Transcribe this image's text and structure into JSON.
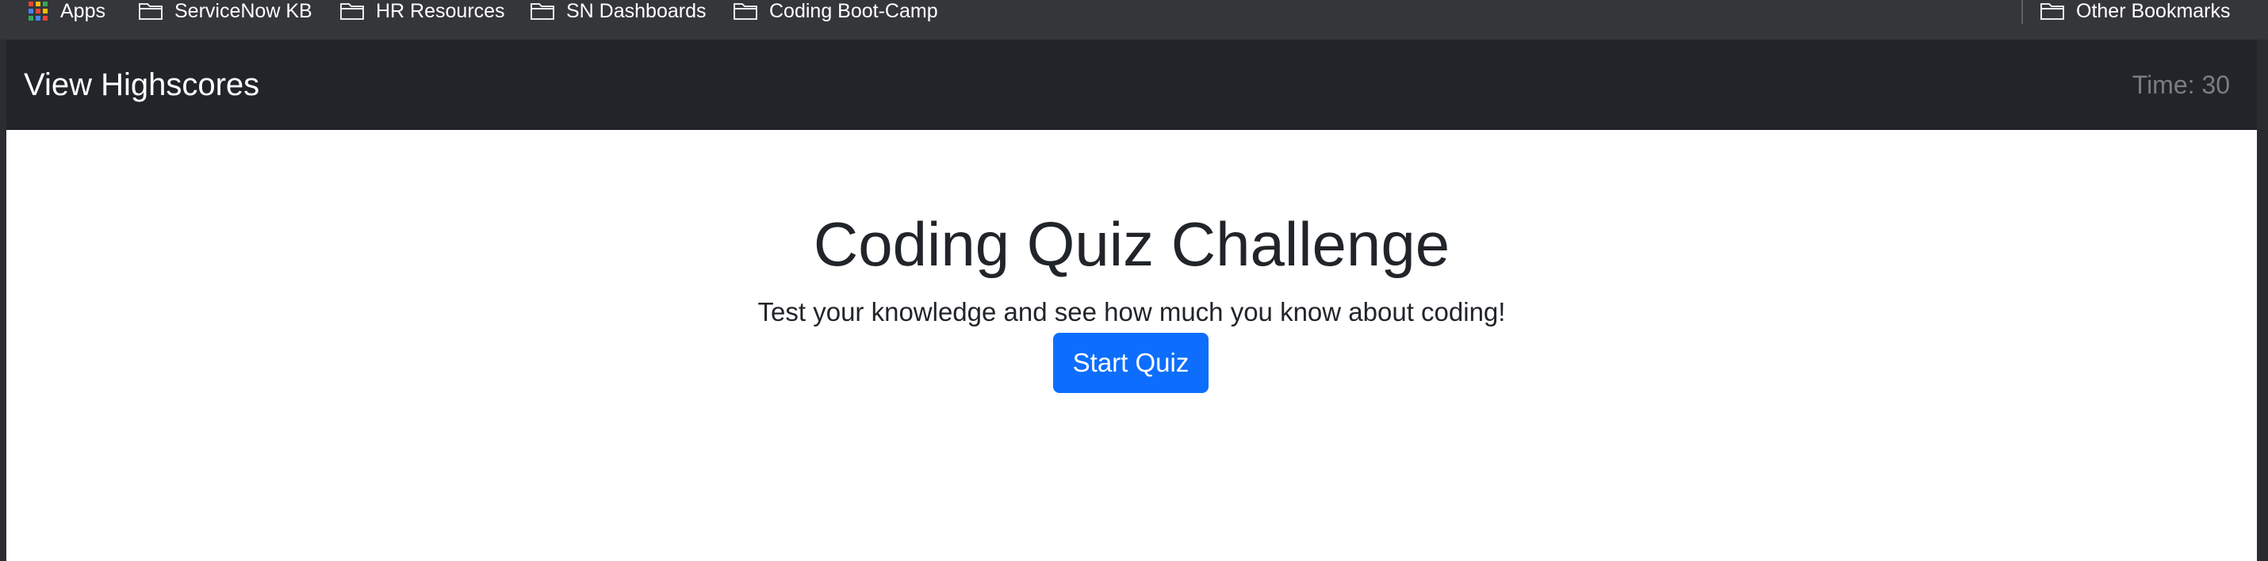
{
  "bookmarks": {
    "items": [
      {
        "label": "Apps",
        "icon": "apps-grid-icon"
      },
      {
        "label": "ServiceNow KB",
        "icon": "folder-icon"
      },
      {
        "label": "HR Resources",
        "icon": "folder-icon"
      },
      {
        "label": "SN Dashboards",
        "icon": "folder-icon"
      },
      {
        "label": "Coding Boot-Camp",
        "icon": "folder-icon"
      }
    ],
    "other": {
      "label": "Other Bookmarks",
      "icon": "folder-icon"
    }
  },
  "navbar": {
    "highscores_link": "View Highscores",
    "timer": "Time: 30"
  },
  "main": {
    "title": "Coding Quiz Challenge",
    "subtitle": "Test your knowledge and see how much you know about coding!",
    "start_button": "Start Quiz"
  },
  "colors": {
    "bookmarks_bar": "#35363a",
    "navbar": "#212529",
    "primary_button": "#0d6efd",
    "timer_text": "#7a7d82"
  }
}
